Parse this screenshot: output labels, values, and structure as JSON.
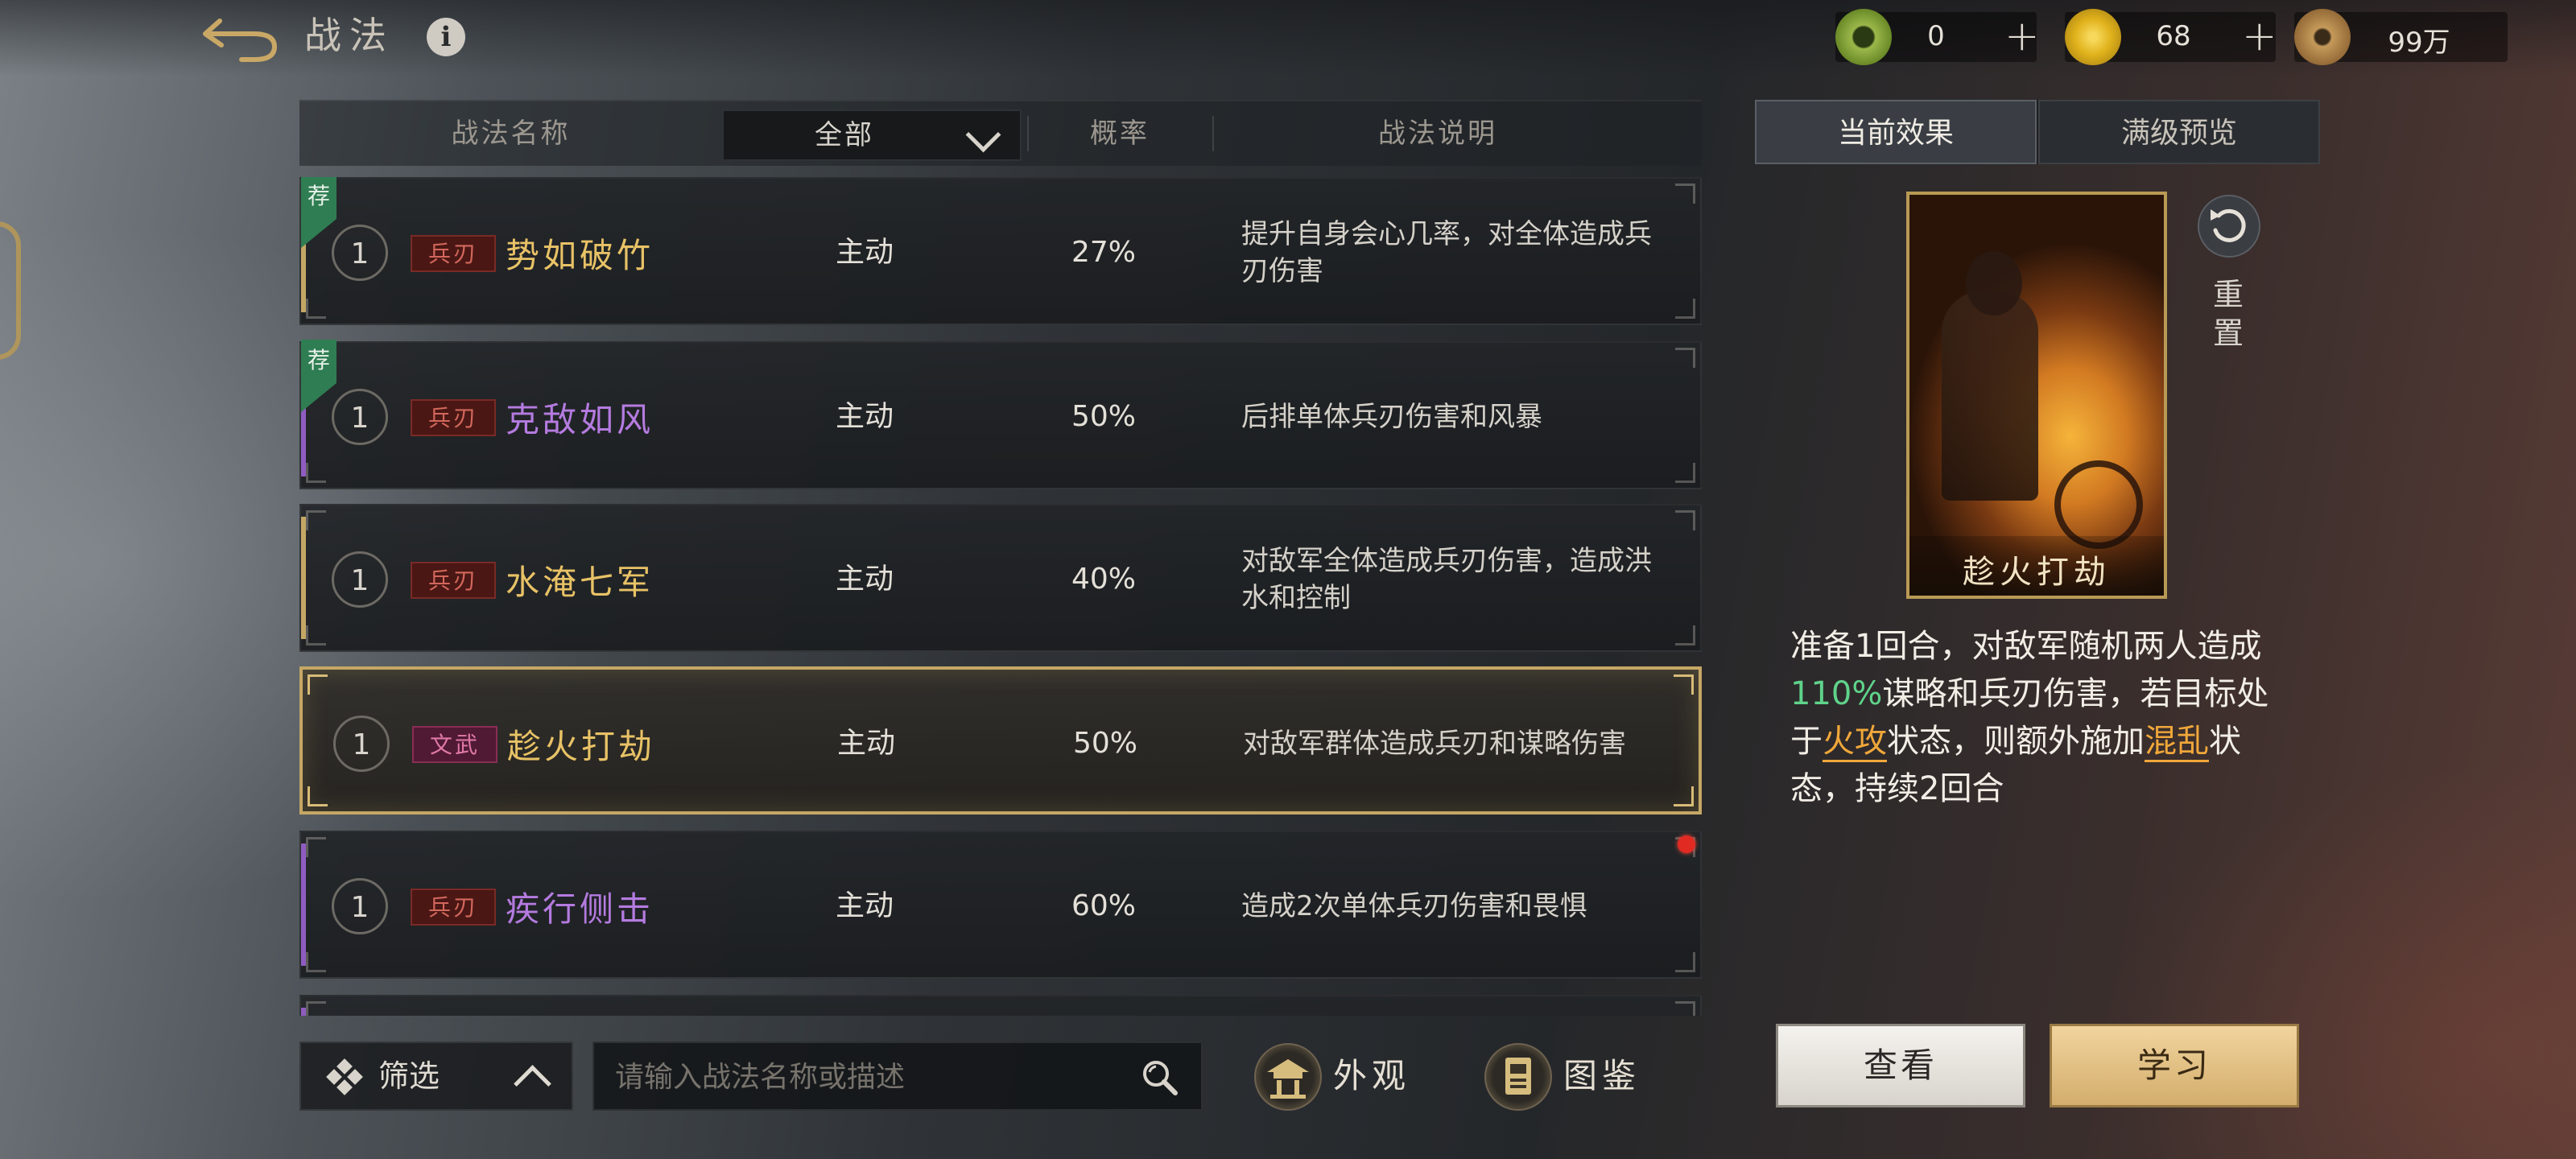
{
  "header": {
    "title": "战法",
    "currencies": [
      {
        "icon": "jade-coin-icon",
        "value": "0",
        "color": "#9bb84a"
      },
      {
        "icon": "gold-coin-icon",
        "value": "68",
        "color": "#e0b21c"
      },
      {
        "icon": "copper-coin-icon",
        "value": "99万",
        "color": "#b88a4a"
      }
    ]
  },
  "list": {
    "columns": {
      "name": "战法名称",
      "filter": "全部",
      "rate": "概率",
      "desc": "战法说明"
    },
    "rows": [
      {
        "recommended": true,
        "rec_label": "荐",
        "level": "1",
        "tag": "兵刃",
        "name": "势如破竹",
        "name_color": "#e8c266",
        "edge_color": "#c5a765",
        "type": "主动",
        "rate": "27%",
        "desc": "提升自身会心几率，对全体造成兵刃伤害",
        "new": false,
        "selected": false
      },
      {
        "recommended": true,
        "rec_label": "荐",
        "level": "1",
        "tag": "兵刃",
        "name": "克敌如风",
        "name_color": "#b57be0",
        "edge_color": "#8f5cc0",
        "type": "主动",
        "rate": "50%",
        "desc": "后排单体兵刃伤害和风暴",
        "new": false,
        "selected": false
      },
      {
        "recommended": false,
        "level": "1",
        "tag": "兵刃",
        "name": "水淹七军",
        "name_color": "#e8c266",
        "edge_color": "#c5a765",
        "type": "主动",
        "rate": "40%",
        "desc": "对敌军全体造成兵刃伤害，造成洪水和控制",
        "new": false,
        "selected": false
      },
      {
        "recommended": false,
        "level": "1",
        "tag": "文武",
        "name": "趁火打劫",
        "name_color": "#e8c266",
        "edge_color": "#c5a765",
        "type": "主动",
        "rate": "50%",
        "desc": "对敌军群体造成兵刃和谋略伤害",
        "new": false,
        "selected": true
      },
      {
        "recommended": false,
        "level": "1",
        "tag": "兵刃",
        "name": "疾行侧击",
        "name_color": "#b57be0",
        "edge_color": "#8f5cc0",
        "type": "主动",
        "rate": "60%",
        "desc": "造成2次单体兵刃伤害和畏惧",
        "new": true,
        "selected": false
      }
    ]
  },
  "bottom": {
    "filter_label": "筛选",
    "search_placeholder": "请输入战法名称或描述",
    "appearance_label": "外观",
    "handbook_label": "图鉴"
  },
  "detail": {
    "tab_current": "当前效果",
    "tab_max": "满级预览",
    "card_name": "趁火打劫",
    "reset_label": "重置",
    "effect": {
      "p1": "准备1回合，对敌军随机两人造成",
      "pct": "110%",
      "p2": "谋略和兵刃伤害，若目标处于",
      "k1": "火攻",
      "p3": "状态，则额外施加",
      "k2": "混乱",
      "p4": "状态，持续2回合"
    },
    "view_label": "查看",
    "learn_label": "学习"
  }
}
